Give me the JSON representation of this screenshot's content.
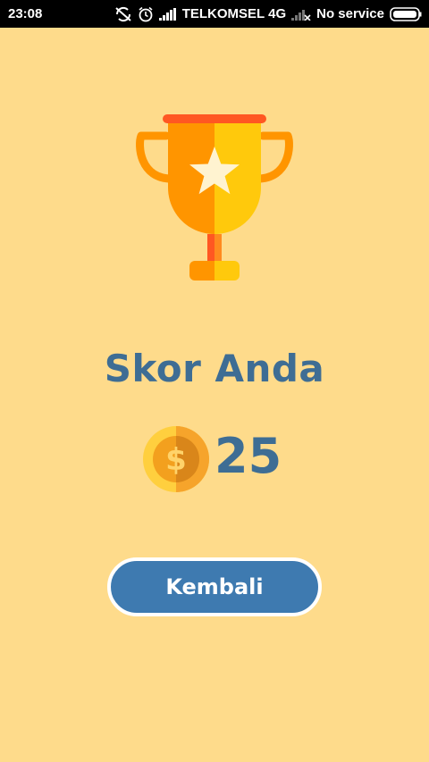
{
  "status_bar": {
    "time": "23:08",
    "carrier": "TELKOMSEL 4G",
    "service": "No service",
    "icons": [
      "sync-off-icon",
      "alarm-icon",
      "signal-icon",
      "signal-weak-icon",
      "battery-icon"
    ]
  },
  "result": {
    "title": "Skor Anda",
    "score": "25"
  },
  "actions": {
    "back_label": "Kembali"
  },
  "colors": {
    "background": "#fedb8b",
    "primary_text": "#3e6d94",
    "button": "#3e7ab0",
    "trophy_orange": "#ff9500",
    "trophy_yellow": "#ffc90c",
    "trophy_red": "#ff5722"
  }
}
